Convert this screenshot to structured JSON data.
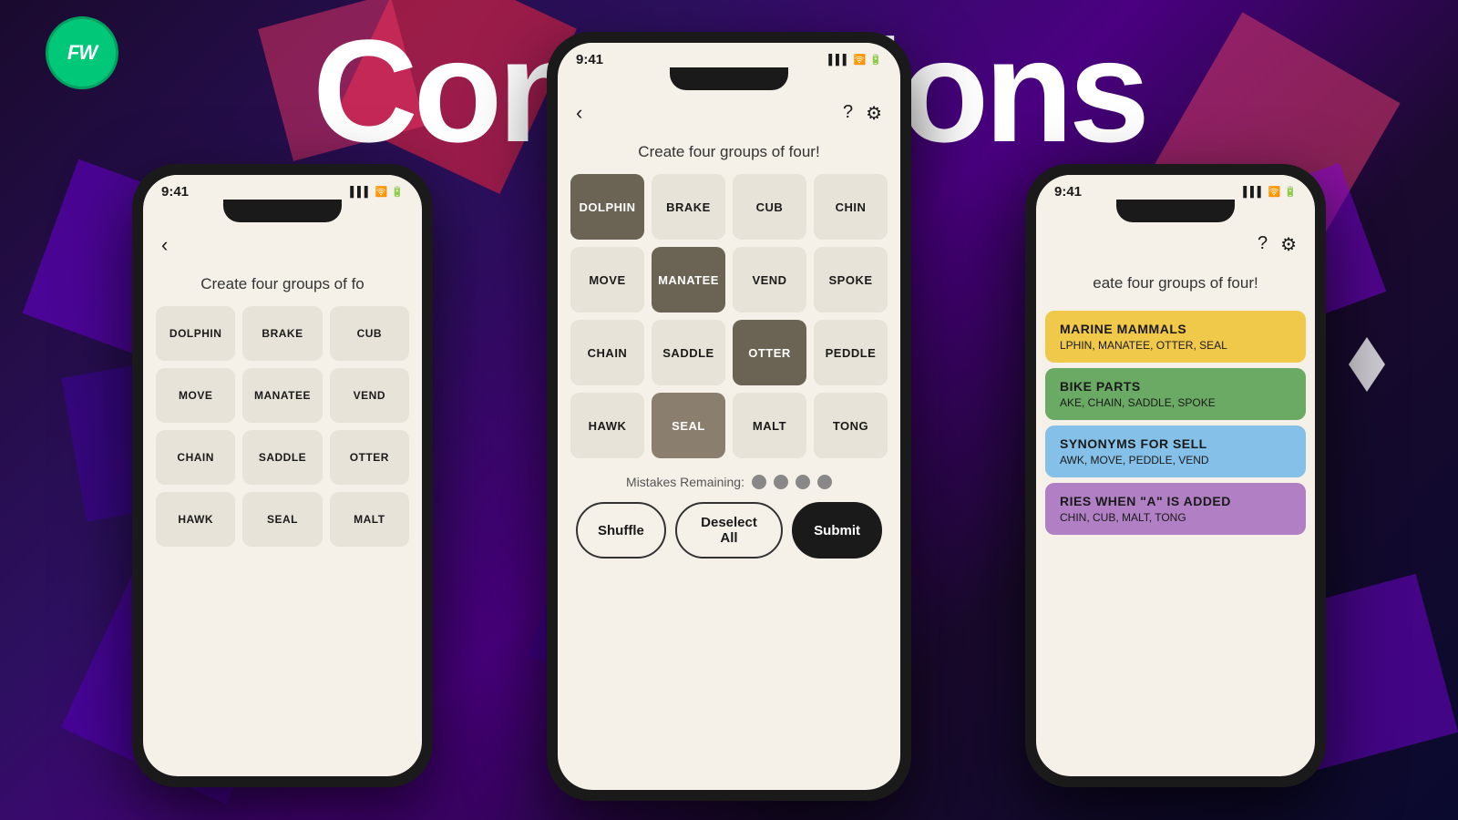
{
  "background": {
    "colors": [
      "#1a0a2e",
      "#2d1060",
      "#4a0080"
    ]
  },
  "logo": {
    "text": "FW",
    "color": "#00c878"
  },
  "title": "Connections",
  "center_phone": {
    "status": {
      "time": "9:41",
      "icons": [
        "▌▌▌",
        "WiFi",
        "🔋"
      ]
    },
    "game_title": "Create four groups of four!",
    "tiles": [
      {
        "word": "DOLPHIN",
        "selected": "dark"
      },
      {
        "word": "BRAKE",
        "selected": "none"
      },
      {
        "word": "CUB",
        "selected": "none"
      },
      {
        "word": "CHIN",
        "selected": "none"
      },
      {
        "word": "MOVE",
        "selected": "none"
      },
      {
        "word": "MANATEE",
        "selected": "dark"
      },
      {
        "word": "VEND",
        "selected": "none"
      },
      {
        "word": "SPOKE",
        "selected": "none"
      },
      {
        "word": "CHAIN",
        "selected": "none"
      },
      {
        "word": "SADDLE",
        "selected": "none"
      },
      {
        "word": "OTTER",
        "selected": "dark"
      },
      {
        "word": "PEDDLE",
        "selected": "none"
      },
      {
        "word": "HAWK",
        "selected": "none"
      },
      {
        "word": "SEAL",
        "selected": "medium"
      },
      {
        "word": "MALT",
        "selected": "none"
      },
      {
        "word": "TONG",
        "selected": "none"
      }
    ],
    "mistakes_label": "Mistakes Remaining:",
    "mistakes_count": 4,
    "buttons": {
      "shuffle": "Shuffle",
      "deselect": "Deselect All",
      "submit": "Submit"
    }
  },
  "left_phone": {
    "status": {
      "time": "9:41"
    },
    "game_title": "Create four groups of fo",
    "tiles": [
      {
        "word": "DOLPHIN",
        "selected": "none"
      },
      {
        "word": "BRAKE",
        "selected": "none"
      },
      {
        "word": "CUB",
        "selected": "none"
      },
      {
        "word": "MOVE",
        "selected": "none"
      },
      {
        "word": "MANATEE",
        "selected": "none"
      },
      {
        "word": "VEND",
        "selected": "none"
      },
      {
        "word": "CHAIN",
        "selected": "none"
      },
      {
        "word": "SADDLE",
        "selected": "none"
      },
      {
        "word": "OTTER",
        "selected": "none"
      },
      {
        "word": "HAWK",
        "selected": "none"
      },
      {
        "word": "SEAL",
        "selected": "none"
      },
      {
        "word": "MALT",
        "selected": "none"
      }
    ]
  },
  "right_phone": {
    "status": {
      "time": "9:41"
    },
    "game_title": "eate four groups of four!",
    "categories": [
      {
        "color": "yellow",
        "title": "MARINE MAMMALS",
        "words": "LPHIN, MANATEE, OTTER, SEAL"
      },
      {
        "color": "green",
        "title": "BIKE PARTS",
        "words": "AKE, CHAIN, SADDLE, SPOKE"
      },
      {
        "color": "blue",
        "title": "SYNONYMS FOR SELL",
        "words": "AWK, MOVE, PEDDLE, VEND"
      },
      {
        "color": "purple",
        "title": "RIES WHEN \"A\" IS ADDED",
        "words": "CHIN, CUB, MALT, TONG"
      }
    ]
  }
}
